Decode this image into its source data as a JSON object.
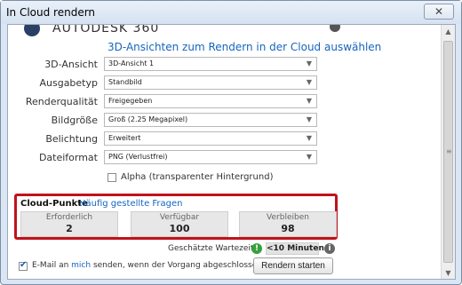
{
  "window": {
    "title": "In Cloud rendern",
    "close_glyph": "✕"
  },
  "brand": {
    "text": "AUTODESK 360"
  },
  "heading": "3D-Ansichten zum Rendern in der Cloud auswählen",
  "form": {
    "rows": [
      {
        "label": "3D-Ansicht",
        "value": "3D-Ansicht 1"
      },
      {
        "label": "Ausgabetyp",
        "value": "Standbild"
      },
      {
        "label": "Renderqualität",
        "value": "Freigegeben"
      },
      {
        "label": "Bildgröße",
        "value": "Groß (2.25 Megapixel)"
      },
      {
        "label": "Belichtung",
        "value": "Erweitert"
      },
      {
        "label": "Dateiformat",
        "value": "PNG (Verlustfrei)"
      }
    ],
    "alpha_label": "Alpha (transparenter Hintergrund)",
    "alpha_checked": false
  },
  "cloud": {
    "title": "Cloud-Punkte",
    "faq_link": "Häufig gestellte Fragen",
    "stats": [
      {
        "label": "Erforderlich",
        "value": "2"
      },
      {
        "label": "Verfügbar",
        "value": "100"
      },
      {
        "label": "Verbleiben",
        "value": "98"
      }
    ],
    "highlight_color": "#c1121b"
  },
  "wait": {
    "label": "Geschätzte Wartezeit",
    "value": "<10 Minuten",
    "green_icon": "!",
    "info_icon": "i"
  },
  "email": {
    "prefix": "E-Mail an ",
    "link": "mich",
    "suffix": " senden, wenn der Vorgang abgeschlossen ist",
    "checked": true
  },
  "actions": {
    "render_label": "Rendern starten"
  },
  "colors": {
    "accent": "#1565c0",
    "status_green": "#35a13d"
  }
}
